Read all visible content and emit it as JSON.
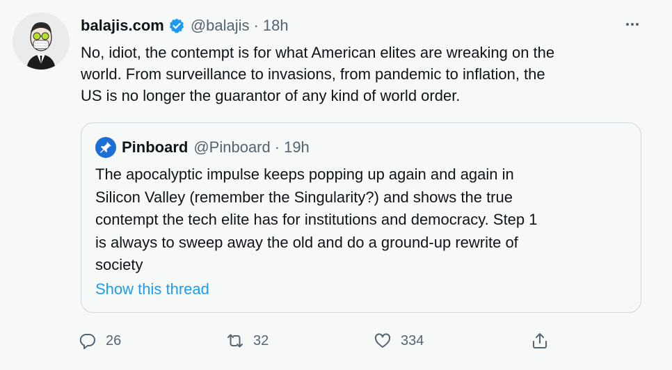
{
  "tweet": {
    "author_name": "balajis.com",
    "author_handle": "@balajis",
    "separator": "·",
    "time": "18h",
    "text_lines": [
      "No, idiot, the contempt is for what American elites are wreaking on the",
      "world. From surveillance to invasions, from pandemic to inflation, the",
      "US is no longer the guarantor of any kind of world order."
    ]
  },
  "quote": {
    "author_name": "Pinboard",
    "author_handle": "@Pinboard",
    "separator": "·",
    "time": "19h",
    "text_lines": [
      "The apocalyptic impulse keeps popping up again and again in",
      "Silicon Valley (remember the Singularity?) and shows the true",
      "contempt the tech elite has for institutions and democracy. Step 1",
      "is always to sweep away the old and do a ground-up rewrite of",
      "society"
    ],
    "show_thread_label": "Show this thread"
  },
  "actions": {
    "replies": "26",
    "retweets": "32",
    "likes": "334"
  },
  "colors": {
    "background": "#f7f9f9",
    "text": "#0f1419",
    "secondary": "#536471",
    "link": "#1d9bf0",
    "verified": "#1d9bf0",
    "border": "#cfd9de"
  },
  "icons": [
    "verified-badge-icon",
    "more-icon",
    "reply-icon",
    "retweet-icon",
    "like-icon",
    "share-icon",
    "pinboard-logo-icon"
  ]
}
